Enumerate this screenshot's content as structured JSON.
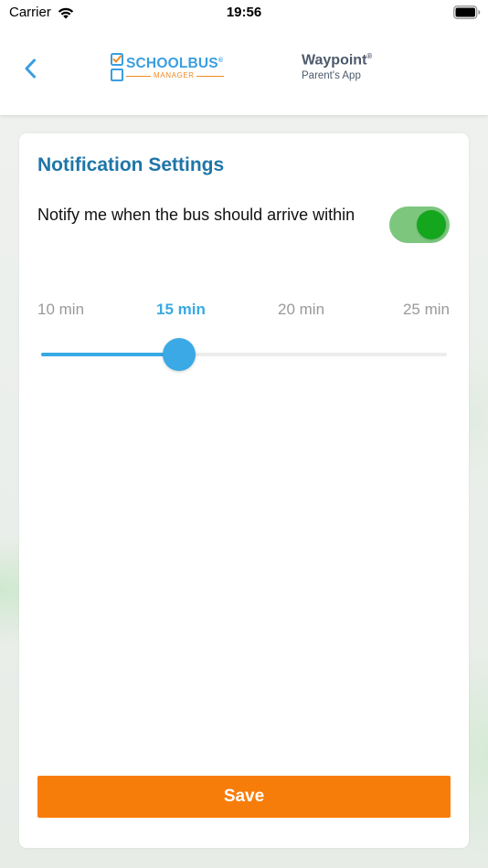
{
  "status_bar": {
    "carrier": "Carrier",
    "time": "19:56"
  },
  "header": {
    "back_icon": "chevron-left-icon",
    "logo": {
      "title": "SCHOOLBUS",
      "trademark": "®",
      "subtitle": "MANAGER"
    },
    "app": {
      "title": "Waypoint",
      "trademark": "®",
      "subtitle": "Parent's App"
    }
  },
  "settings": {
    "title": "Notification Settings",
    "notify_label": "Notify me when the bus should arrive within",
    "toggle_on": true,
    "slider": {
      "options": [
        "10 min",
        "15 min",
        "20 min",
        "25 min"
      ],
      "selected_index": 1,
      "selected": "15 min",
      "value_fraction": 0.34
    },
    "save_label": "Save"
  },
  "colors": {
    "accent": "#37a9e3",
    "title": "#1e75a8",
    "toggle_track": "#7cc67e",
    "toggle_knob": "#14a61c",
    "save": "#f77d0b",
    "logo_orange": "#f08a24"
  }
}
